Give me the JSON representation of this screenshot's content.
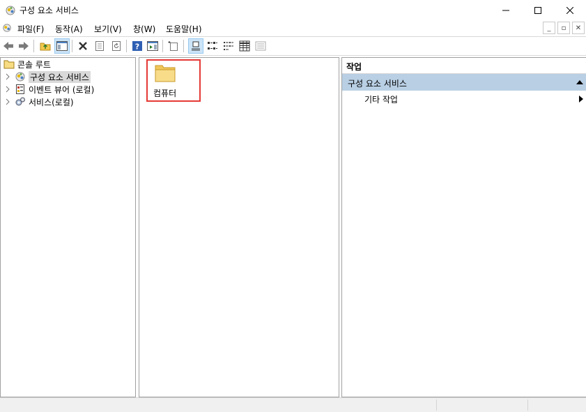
{
  "window": {
    "title": "구성 요소 서비스"
  },
  "menu": [
    "파일(F)",
    "동작(A)",
    "보기(V)",
    "창(W)",
    "도움말(H)"
  ],
  "tree": {
    "root": "콘솔 루트",
    "items": [
      "구성 요소 서비스",
      "이벤트 뷰어 (로컬)",
      "서비스(로컬)"
    ]
  },
  "center": {
    "items": [
      "컴퓨터"
    ]
  },
  "actions": {
    "header": "작업",
    "group": "구성 요소 서비스",
    "items": [
      "기타 작업"
    ]
  },
  "colors": {
    "selection_highlight": "#d9d9d9",
    "action_group_bg": "#b9cfe4",
    "callout_border": "#e53935"
  }
}
